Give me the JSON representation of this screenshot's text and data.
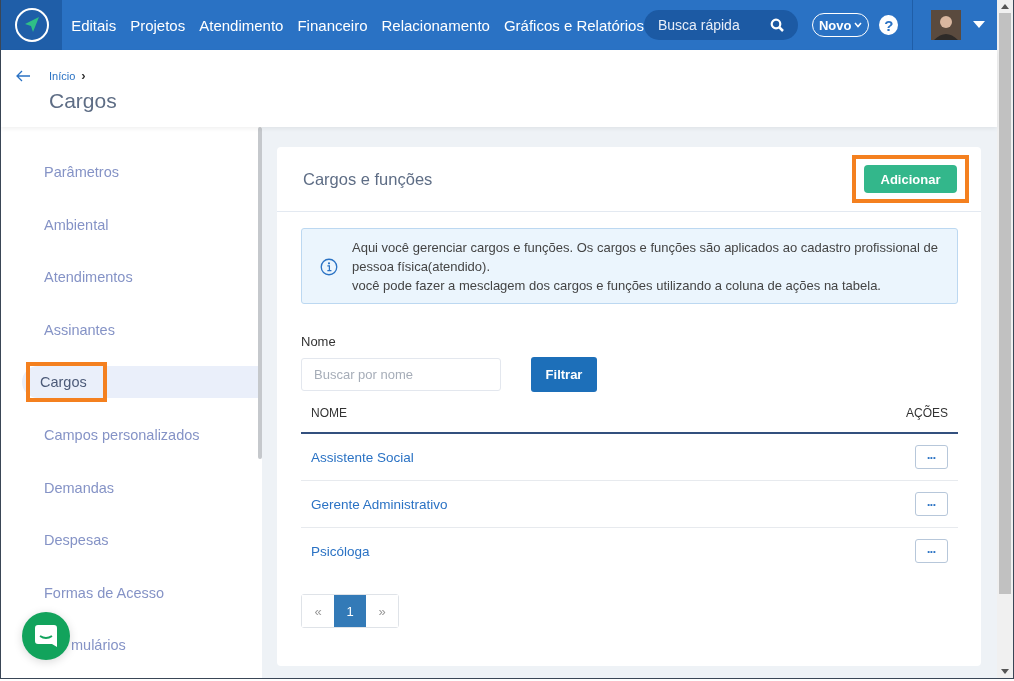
{
  "nav": {
    "items": [
      "Editais",
      "Projetos",
      "Atendimento",
      "Financeiro",
      "Relacionamento",
      "Gráficos e Relatórios"
    ],
    "search": {
      "placeholder": "Busca rápida"
    },
    "new_button": "Novo",
    "help": "?"
  },
  "breadcrumb": {
    "items": [
      "Início"
    ],
    "separator": "›"
  },
  "page_title": "Cargos",
  "sidebar": {
    "items": [
      {
        "label": "Parâmetros",
        "selected": false,
        "highlighted": false
      },
      {
        "label": "Ambiental",
        "selected": false,
        "highlighted": false
      },
      {
        "label": "Atendimentos",
        "selected": false,
        "highlighted": false
      },
      {
        "label": "Assinantes",
        "selected": false,
        "highlighted": false
      },
      {
        "label": "Cargos",
        "selected": true,
        "highlighted": true
      },
      {
        "label": "Campos personalizados",
        "selected": false,
        "highlighted": false
      },
      {
        "label": "Demandas",
        "selected": false,
        "highlighted": false
      },
      {
        "label": "Despesas",
        "selected": false,
        "highlighted": false
      },
      {
        "label": "Formas de Acesso",
        "selected": false,
        "highlighted": false
      },
      {
        "label": "mulários",
        "selected": false,
        "highlighted": false
      }
    ]
  },
  "card": {
    "title": "Cargos e funções",
    "add_button": {
      "label": "Adicionar",
      "highlighted": true
    },
    "info": "Aqui você gerenciar cargos e funções. Os cargos e funções são aplicados ao cadastro profissional de pessoa física(atendido).\nvocê pode fazer a mesclagem dos cargos e funções utilizando a coluna de ações na tabela.",
    "filter": {
      "label": "Nome",
      "placeholder": "Buscar por nome",
      "button": "Filtrar"
    },
    "table": {
      "columns": [
        "NOME",
        "AÇÕES"
      ],
      "rows": [
        {
          "name": "Assistente Social",
          "action": "•••"
        },
        {
          "name": "Gerente Administrativo",
          "action": "•••"
        },
        {
          "name": "Psicóloga",
          "action": "•••"
        }
      ]
    },
    "pagination": [
      {
        "label": "«",
        "selected": false
      },
      {
        "label": "1",
        "selected": true
      },
      {
        "label": "»",
        "selected": false
      }
    ]
  }
}
